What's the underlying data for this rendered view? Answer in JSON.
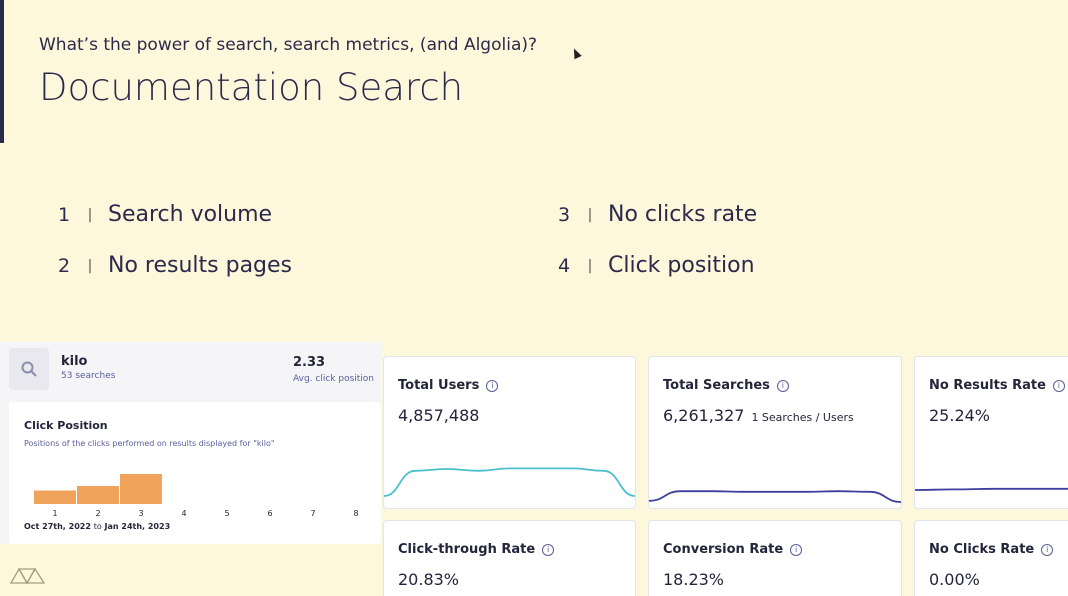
{
  "header": {
    "subtitle": "What’s the power of search, search metrics, (and Algolia)?",
    "title": "Documentation Search"
  },
  "agenda": [
    {
      "num": "1",
      "sep": "|",
      "label": "Search volume"
    },
    {
      "num": "2",
      "sep": "|",
      "label": "No results pages"
    },
    {
      "num": "3",
      "sep": "|",
      "label": "No clicks rate"
    },
    {
      "num": "4",
      "sep": "|",
      "label": "Click position"
    }
  ],
  "query": {
    "name": "kilo",
    "searches": "53 searches",
    "avg_value": "2.33",
    "avg_label": "Avg. click position"
  },
  "click_position": {
    "title": "Click Position",
    "description": "Positions of the clicks performed on results displayed for \"kilo\"",
    "positions": [
      "1",
      "2",
      "3",
      "4",
      "5",
      "6",
      "7",
      "8"
    ],
    "values": [
      0.45,
      0.6,
      1.0,
      0,
      0,
      0,
      0,
      0
    ],
    "date_from": "Oct 27th, 2022",
    "date_sep": "to",
    "date_to": "Jan 24th, 2023",
    "bar_color": "#f0a35a"
  },
  "metrics": [
    {
      "label": "Total Users",
      "value": "4,857,488",
      "extra": "",
      "line_color": "#4cbfcf",
      "trend": [
        0.2,
        0.62,
        0.65,
        0.62,
        0.66,
        0.66,
        0.66,
        0.62,
        0.2
      ]
    },
    {
      "label": "Total Searches",
      "value": "6,261,327",
      "extra": "1 Searches / Users",
      "line_color": "#3c3f9e",
      "trend": [
        0.12,
        0.28,
        0.28,
        0.27,
        0.27,
        0.27,
        0.28,
        0.27,
        0.1
      ]
    },
    {
      "label": "No Results Rate",
      "value": "25.24%",
      "extra": "",
      "line_color": "#3c3f9e",
      "trend": [
        0.3,
        0.31,
        0.32,
        0.32,
        0.32
      ]
    },
    {
      "label": "Click-through Rate",
      "value": "20.83%",
      "extra": ""
    },
    {
      "label": "Conversion Rate",
      "value": "18.23%",
      "extra": ""
    },
    {
      "label": "No Clicks Rate",
      "value": "0.00%",
      "extra": ""
    }
  ],
  "icons": {
    "search": "search-icon",
    "info": "info-icon",
    "logo": "algolia-triangle-logo"
  }
}
